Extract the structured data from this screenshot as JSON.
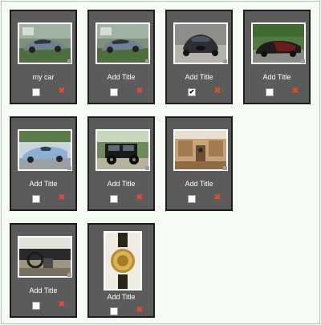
{
  "photos": [
    {
      "title": "my car",
      "selected": false,
      "subject": "silver-coupe-thumbnail",
      "delete_icon": "delete-x-icon"
    },
    {
      "title": "Add Title",
      "selected": false,
      "subject": "silver-coupe-thumbnail",
      "delete_icon": "delete-x-icon"
    },
    {
      "title": "Add Title",
      "selected": true,
      "subject": "black-supercar-thumbnail",
      "delete_icon": "delete-x-icon"
    },
    {
      "title": "Add Title",
      "selected": false,
      "subject": "maroon-supercar-thumbnail",
      "delete_icon": "delete-x-icon"
    },
    {
      "title": "Add Title",
      "selected": false,
      "subject": "blue-roadster-thumbnail",
      "delete_icon": "delete-x-icon"
    },
    {
      "title": "Add Title",
      "selected": false,
      "subject": "black-jeep-thumbnail",
      "delete_icon": "delete-x-icon"
    },
    {
      "title": "Add Title",
      "selected": false,
      "subject": "car-interior-thumbnail",
      "delete_icon": "delete-x-icon"
    },
    {
      "title": "Add Title",
      "selected": false,
      "subject": "dashboard-thumbnail",
      "delete_icon": "delete-x-icon"
    },
    {
      "title": "Add Title",
      "selected": false,
      "subject": "gold-watch-thumbnail",
      "delete_icon": "delete-x-icon"
    }
  ],
  "colors": {
    "page_bg": "#f4fcf4",
    "card_bg": "#5b5b5b",
    "card_border": "#1c1c1c",
    "title_text": "#ffffff",
    "delete_icon": "#e54b2f"
  }
}
